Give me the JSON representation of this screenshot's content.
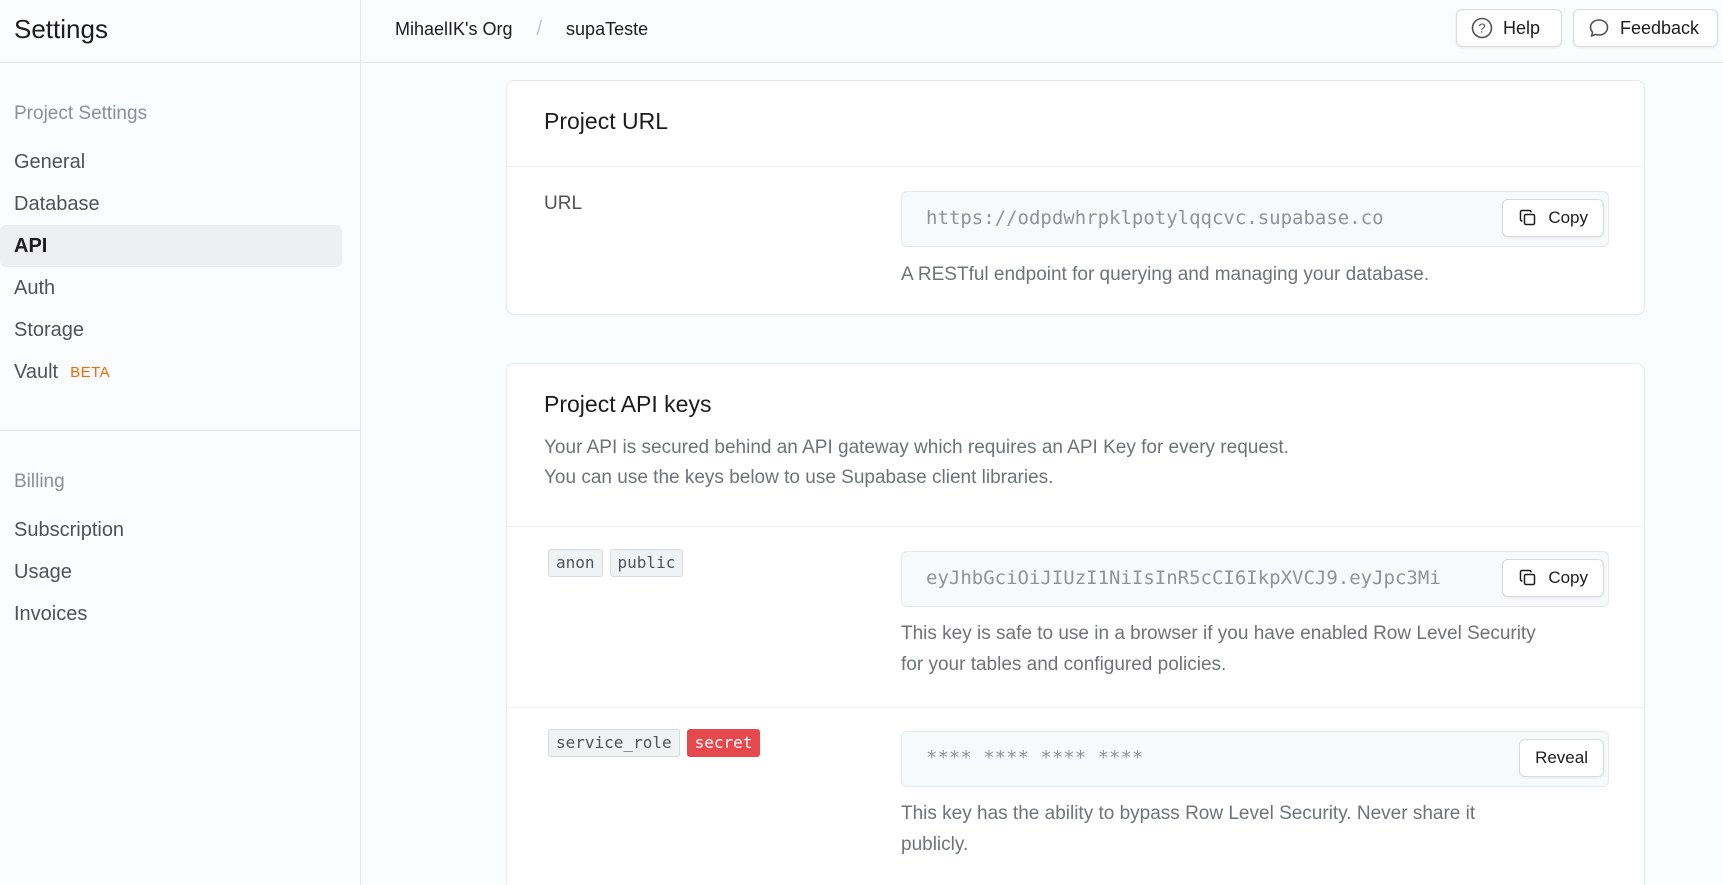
{
  "sidebar": {
    "title": "Settings",
    "project_section": {
      "title": "Project Settings",
      "items": [
        {
          "label": "General"
        },
        {
          "label": "Database"
        },
        {
          "label": "API",
          "active": true
        },
        {
          "label": "Auth"
        },
        {
          "label": "Storage"
        },
        {
          "label": "Vault",
          "badge": "BETA"
        }
      ]
    },
    "billing_section": {
      "title": "Billing",
      "items": [
        {
          "label": "Subscription"
        },
        {
          "label": "Usage"
        },
        {
          "label": "Invoices"
        }
      ]
    }
  },
  "topbar": {
    "breadcrumb": [
      "MihaelIK's Org",
      "supaTeste"
    ],
    "breadcrumb_separator": "/",
    "help_label": "Help",
    "feedback_label": "Feedback"
  },
  "project_url": {
    "title": "Project URL",
    "label": "URL",
    "value": "https://odpdwhrpklpotylqqcvc.supabase.co",
    "copy_label": "Copy",
    "description": "A RESTful endpoint for querying and managing your database."
  },
  "api_keys": {
    "title": "Project API keys",
    "description_line1": "Your API is secured behind an API gateway which requires an API Key for every request.",
    "description_line2": "You can use the keys below to use Supabase client libraries.",
    "anon": {
      "tags": [
        "anon",
        "public"
      ],
      "value": "eyJhbGciOiJIUzI1NiIsInR5cCI6IkpXVCJ9.eyJpc3Mi",
      "copy_label": "Copy",
      "description_line1": "This key is safe to use in a browser if you have enabled Row Level Security",
      "description_line2": "for your tables and configured policies."
    },
    "service_role": {
      "tags": [
        "service_role",
        "secret"
      ],
      "value": "**** **** **** ****",
      "reveal_label": "Reveal",
      "description_line1": "This key has the ability to bypass Row Level Security. Never share it",
      "description_line2": "publicly."
    }
  },
  "colors": {
    "accent_beta": "#f76808",
    "secret_tag": "#e5484d"
  }
}
